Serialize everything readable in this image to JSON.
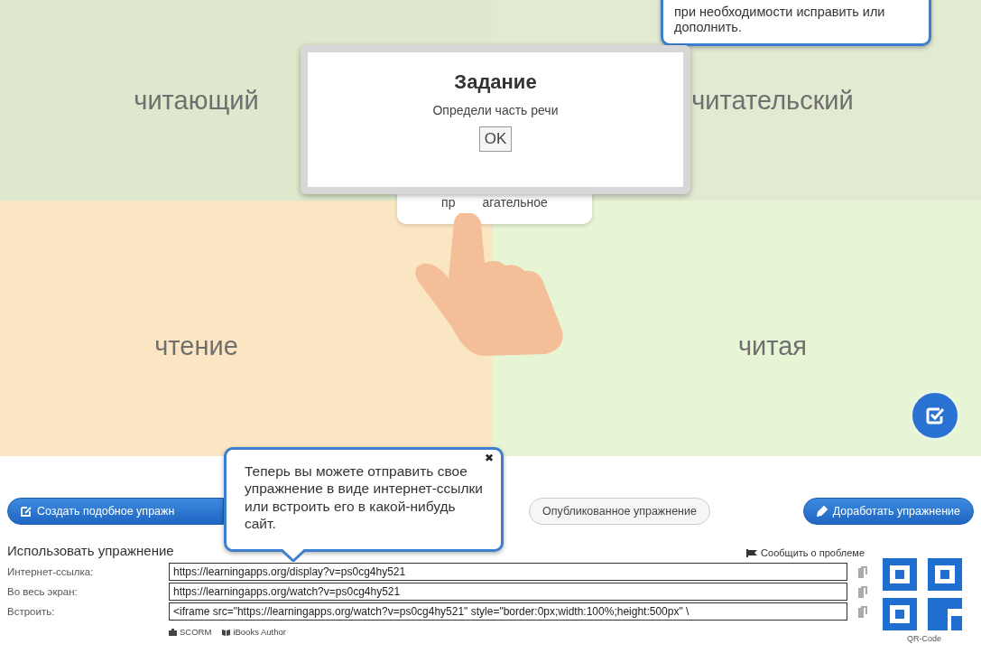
{
  "quadrants": [
    {
      "word": "читающий",
      "color": "#dde8cc"
    },
    {
      "word": "читательский",
      "color": "#e2ead2"
    },
    {
      "word": "чтение",
      "color": "#fbe6c4"
    },
    {
      "word": "читая",
      "color": "#e6f5d4"
    }
  ],
  "answer_card": {
    "parts": [
      "пр",
      "агательное"
    ]
  },
  "dialog": {
    "title": "Задание",
    "text": "Определи часть речи",
    "button": "OK"
  },
  "hint_top": {
    "text": "при необходимости исправить или дополнить."
  },
  "hint_bottom": {
    "text": "Теперь вы можете отправить свое упражнение в виде интернет-ссылки или встроить его в какой-нибудь сайт.",
    "close": "✖"
  },
  "actions": [
    {
      "label": "Создать подобное упражн",
      "kind": "primary"
    },
    {
      "label": "Опубликованное упражнение",
      "kind": "secondary"
    },
    {
      "label": "Доработать упражнение",
      "kind": "primary"
    }
  ],
  "use": {
    "title": "Использовать упражнение",
    "report": "Сообщить о проблеме",
    "rows": [
      {
        "label": "Интернет-ссылка:",
        "value": "https://learningapps.org/display?v=ps0cg4hy521"
      },
      {
        "label": "Во весь экран:",
        "value": "https://learningapps.org/watch?v=ps0cg4hy521"
      },
      {
        "label": "Встроить:",
        "value": "<iframe src=\"https://learningapps.org/watch?v=ps0cg4hy521\" style=\"border:0px;width:100%;height:500px\" \\"
      }
    ],
    "exports": [
      "SCORM",
      "iBooks Author"
    ],
    "qr_label": "QR-Code"
  }
}
